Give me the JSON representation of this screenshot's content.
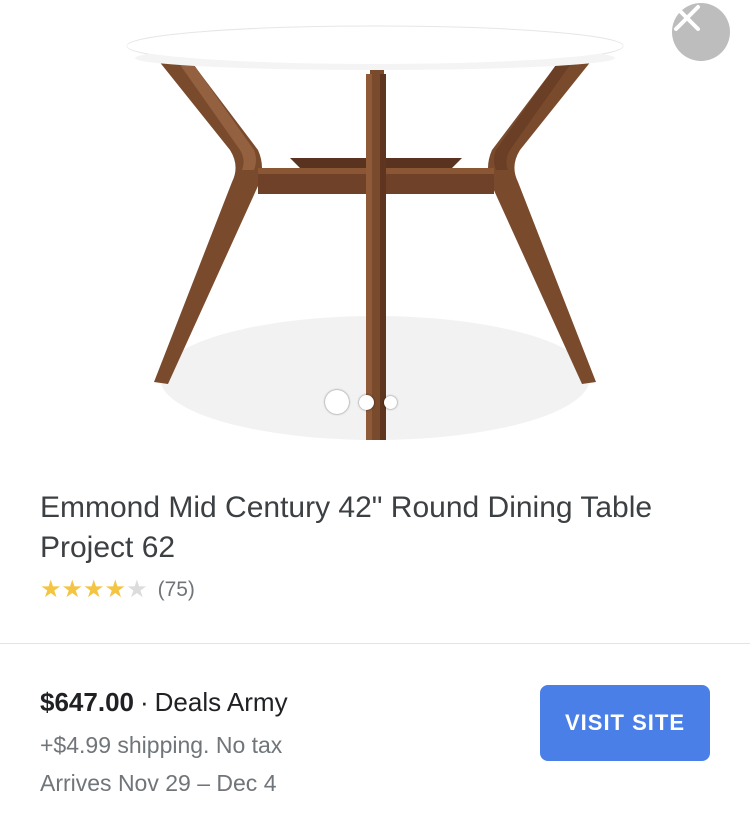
{
  "product": {
    "title_line1": "Emmond Mid Century 42\" Round Dining Table",
    "title_line2": "Project 62",
    "rating": 4,
    "rating_max": 5,
    "review_count": "(75)"
  },
  "carousel": {
    "image_count": 3,
    "active_index": 0
  },
  "offer": {
    "price": "$647.00",
    "separator": "·",
    "store": "Deals Army",
    "shipping": "+$4.99 shipping. No tax",
    "arrives": "Arrives Nov 29 – Dec 4",
    "visit_label": "VISIT SITE"
  },
  "icons": {
    "close": "close-icon",
    "star": "star-icon"
  },
  "colors": {
    "accent": "#4a7fe8",
    "star": "#f4c542",
    "close_bg": "#bdbdbd",
    "wood": "#7a4a2c",
    "tabletop": "#ffffff"
  }
}
